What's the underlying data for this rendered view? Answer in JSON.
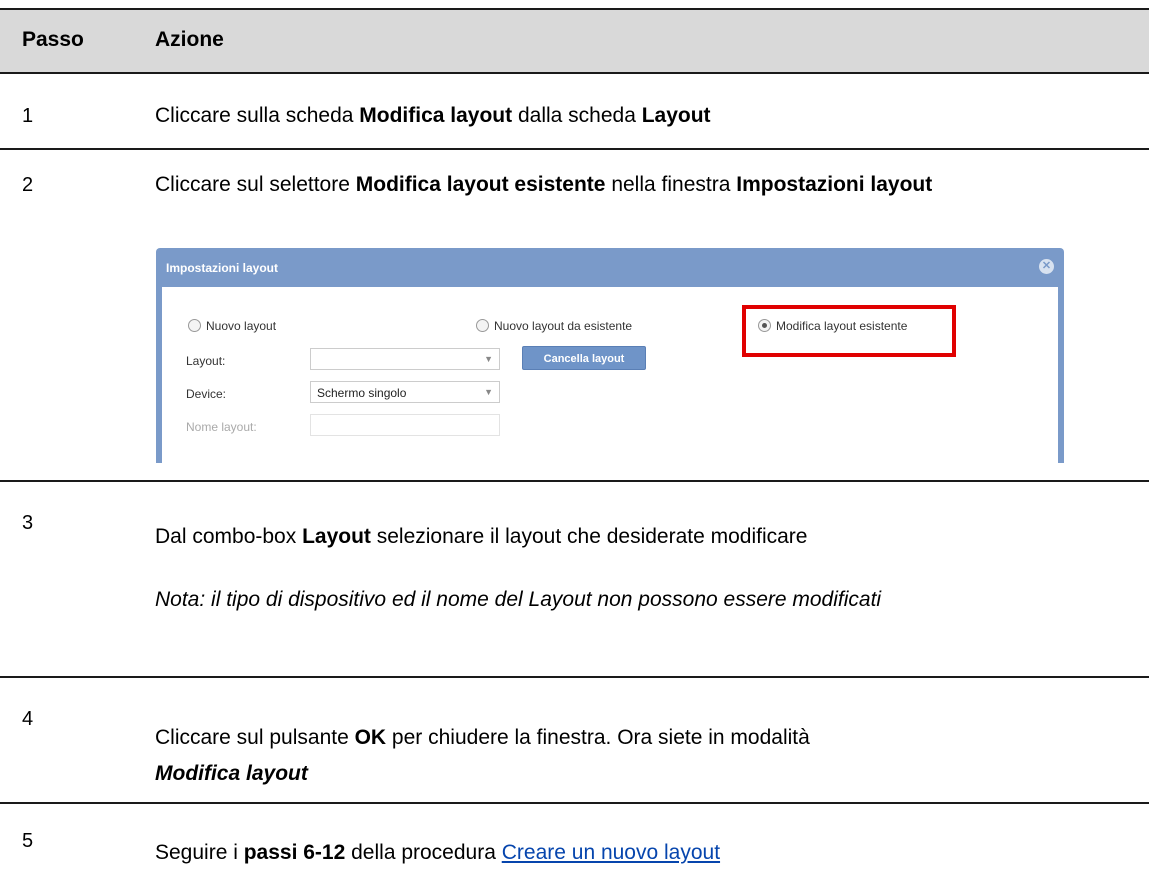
{
  "header": {
    "col_step": "Passo",
    "col_action": "Azione"
  },
  "rows": [
    {
      "step": "1",
      "parts": [
        {
          "t": "Cliccare sulla scheda ",
          "b": false
        },
        {
          "t": "Modifica layout",
          "b": true
        },
        {
          "t": " dalla scheda ",
          "b": false
        },
        {
          "t": "Layout",
          "b": true
        }
      ]
    },
    {
      "step": "2",
      "parts": [
        {
          "t": "Cliccare sul selettore ",
          "b": false
        },
        {
          "t": "Modifica layout esistente",
          "b": true
        },
        {
          "t": " nella finestra ",
          "b": false
        },
        {
          "t": "Impostazioni layout",
          "b": true
        }
      ]
    },
    {
      "step": "3",
      "parts": [
        {
          "t": "Dal combo-box ",
          "b": false
        },
        {
          "t": "Layout",
          "b": true
        },
        {
          "t": " selezionare il layout che desiderate modificare",
          "b": false
        }
      ],
      "note": "Nota: il tipo di dispositivo ed il nome del Layout non possono essere modificati"
    },
    {
      "step": "4",
      "parts": [
        {
          "t": "Cliccare sul pulsante ",
          "b": false
        },
        {
          "t": "OK",
          "b": true
        },
        {
          "t": " per chiudere la finestra. Ora siete in modalità ",
          "b": false
        }
      ],
      "emph": "Modifica layout"
    },
    {
      "step": "5",
      "parts": [
        {
          "t": "Seguire i ",
          "b": false
        },
        {
          "t": "passi 6-12",
          "b": true
        },
        {
          "t": " della procedura ",
          "b": false
        }
      ],
      "link": "Creare un nuovo layout"
    }
  ],
  "dialog": {
    "title": "Impostazioni layout",
    "radio_new": "Nuovo layout",
    "radio_from_existing": "Nuovo layout da esistente",
    "radio_edit_existing": "Modifica layout esistente",
    "label_layout": "Layout:",
    "layout_value": "",
    "button_delete": "Cancella layout",
    "label_device": "Device:",
    "device_value": "Schermo singolo",
    "label_name": "Nome layout:",
    "name_value": ""
  }
}
